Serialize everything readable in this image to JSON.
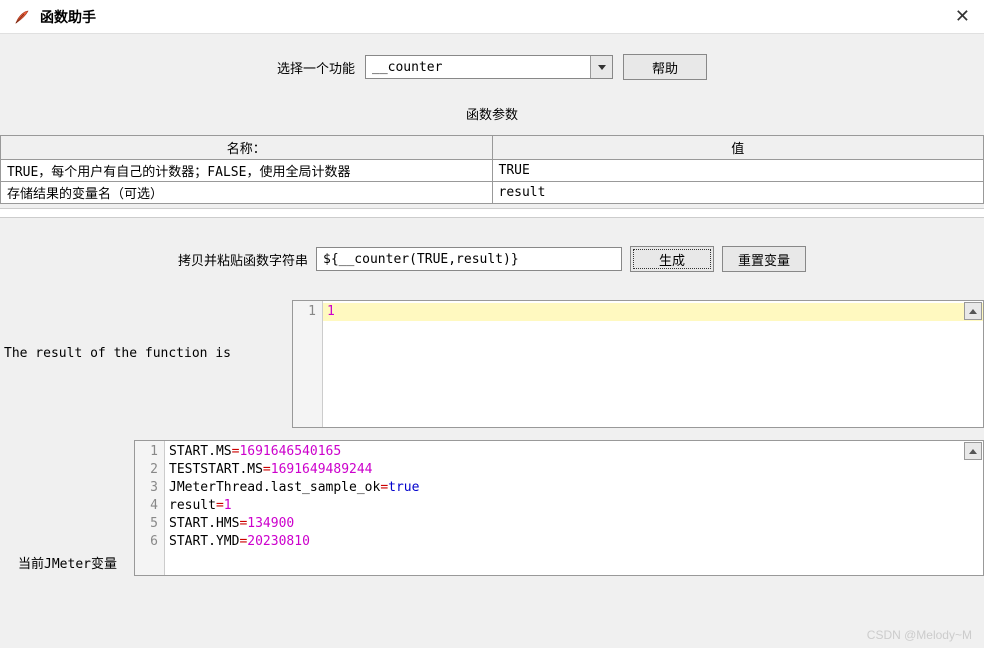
{
  "window": {
    "title": "函数助手"
  },
  "select": {
    "label": "选择一个功能",
    "value": "__counter",
    "help_button": "帮助"
  },
  "params": {
    "section_title": "函数参数",
    "col_name": "名称：",
    "col_value": "值",
    "rows": [
      {
        "name": "TRUE，每个用户有自己的计数器；FALSE，使用全局计数器",
        "value": "TRUE"
      },
      {
        "name": "存储结果的变量名（可选）",
        "value": "result"
      }
    ]
  },
  "copy": {
    "label": "拷贝并粘贴函数字符串",
    "value": "${__counter(TRUE,result)}",
    "generate_button": "生成",
    "reset_button": "重置变量"
  },
  "result": {
    "label": "The result of the function is",
    "line_no": "1",
    "value": "1"
  },
  "vars": {
    "label_prefix": "当前",
    "label_mid": "JMeter",
    "label_suffix": "变量",
    "lines": [
      {
        "n": "1",
        "key": "START.MS",
        "val": "1691646540165",
        "type": "num"
      },
      {
        "n": "2",
        "key": "TESTSTART.MS",
        "val": "1691649489244",
        "type": "num"
      },
      {
        "n": "3",
        "key": "JMeterThread.last_sample_ok",
        "val": "true",
        "type": "bool"
      },
      {
        "n": "4",
        "key": "result",
        "val": "1",
        "type": "num"
      },
      {
        "n": "5",
        "key": "START.HMS",
        "val": "134900",
        "type": "num"
      },
      {
        "n": "6",
        "key": "START.YMD",
        "val": "20230810",
        "type": "num"
      }
    ]
  },
  "watermark": "CSDN @Melody~M"
}
